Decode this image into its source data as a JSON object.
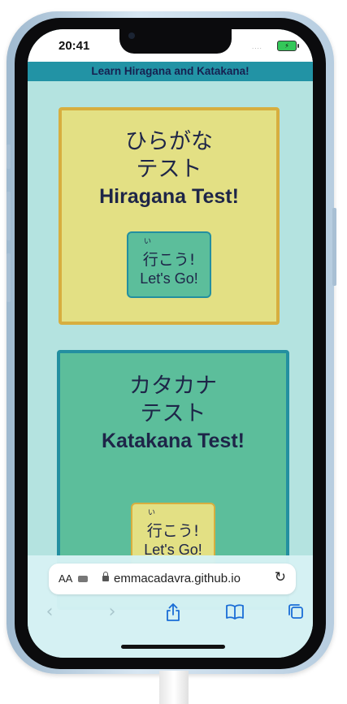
{
  "status_bar": {
    "time": "20:41",
    "signal": "....",
    "battery": "⚡"
  },
  "header": {
    "title": "Learn Hiragana and Katakana!"
  },
  "hiragana_card": {
    "jp_line1": "ひらがな",
    "jp_line2": "テスト",
    "en_title": "Hiragana Test!",
    "button": {
      "ruby": "い",
      "jp": "行こう!",
      "en": "Let's Go!"
    }
  },
  "katakana_card": {
    "jp_line1": "カタカナ",
    "jp_line2": "テスト",
    "en_title": "Katakana Test!",
    "button": {
      "ruby": "い",
      "jp": "行こう!",
      "en": "Let's Go!"
    }
  },
  "safari": {
    "text_size_label": "AA",
    "url": "emmacadavra.github.io",
    "icons": [
      "extension-icon",
      "lock-icon",
      "reload-icon",
      "back-icon",
      "forward-icon",
      "share-icon",
      "bookmarks-icon",
      "tabs-icon"
    ]
  },
  "colors": {
    "page_background": "#b4e3e0",
    "header_background": "#2293a5",
    "text_dark": "#1e2548",
    "yellow_card": "#e3e084",
    "yellow_border": "#d7ae3f",
    "green_card": "#5cbe9b",
    "green_border": "#238fa0",
    "safari_blue": "#1a6dd6"
  }
}
